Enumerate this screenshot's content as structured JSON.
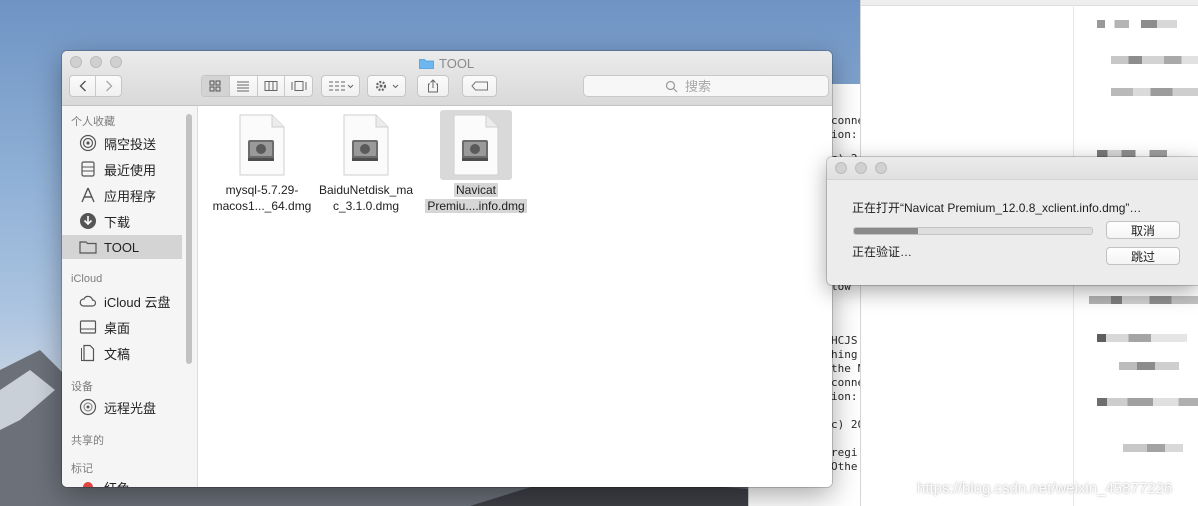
{
  "finder": {
    "title": "TOOL",
    "search_placeholder": "搜索",
    "sidebar": {
      "sections": [
        {
          "label": "个人收藏"
        },
        {
          "label": "iCloud"
        },
        {
          "label": "设备"
        },
        {
          "label": "共享的"
        },
        {
          "label": "标记"
        }
      ],
      "items": [
        {
          "label": "隔空投送",
          "icon": "airdrop-icon"
        },
        {
          "label": "最近使用",
          "icon": "recents-icon"
        },
        {
          "label": "应用程序",
          "icon": "applications-icon"
        },
        {
          "label": "下载",
          "icon": "downloads-icon"
        },
        {
          "label": "TOOL",
          "icon": "folder-icon",
          "selected": true
        },
        {
          "label": "iCloud 云盘",
          "icon": "cloud-icon"
        },
        {
          "label": "桌面",
          "icon": "desktop-icon"
        },
        {
          "label": "文稿",
          "icon": "documents-icon"
        },
        {
          "label": "远程光盘",
          "icon": "disc-icon"
        },
        {
          "label": "红色",
          "icon": "red-tag-icon"
        }
      ]
    },
    "files": [
      {
        "line1": "mysql-5.7.29-",
        "line2": "macos1..._64.dmg",
        "icon": "dmg-icon"
      },
      {
        "line1": "BaiduNetdisk_ma",
        "line2": "c_3.1.0.dmg",
        "icon": "dmg-icon"
      },
      {
        "line1": "Navicat",
        "line2": "Premiu....info.dmg",
        "icon": "dmg-icon",
        "selected": true
      }
    ]
  },
  "dialog": {
    "message": "正在打开“Navicat Premium_12.0.8_xclient.info.dmg”…",
    "status": "正在验证…",
    "progress": 0.27,
    "cancel_label": "取消",
    "skip_label": "跳过"
  },
  "terminal": {
    "lines": [
      "conne",
      "ion:",
      "c) 2",
      "low",
      "HCJS",
      "hing",
      "the N",
      "conne",
      "ion:",
      "c) 20",
      "regi",
      "Othe"
    ]
  },
  "watermark": "https://blog.csdn.net/weixin_45877226",
  "colors": {
    "sidebar_selected": "#d4d4d4",
    "file_selected": "#d9d9d9",
    "progress_fill": "#8a8a8a",
    "tag_red": "#e0443e"
  }
}
